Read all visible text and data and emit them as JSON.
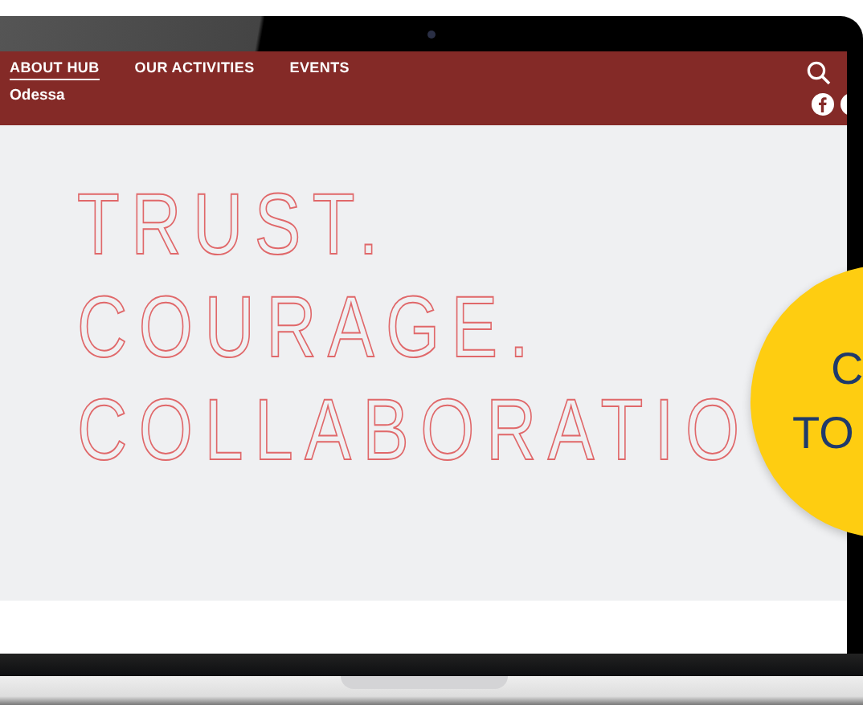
{
  "nav": {
    "tabs": [
      {
        "label": "ABOUT HUB",
        "selected": true
      },
      {
        "label": "OUR ACTIVITIES",
        "selected": false
      },
      {
        "label": "EVENTS",
        "selected": false
      }
    ],
    "location": "Odessa"
  },
  "hero": {
    "lines": [
      "TRUST.",
      "COURAGE.",
      "COLLABORATIO"
    ]
  },
  "badge": {
    "lines": [
      "C",
      "TO"
    ]
  }
}
